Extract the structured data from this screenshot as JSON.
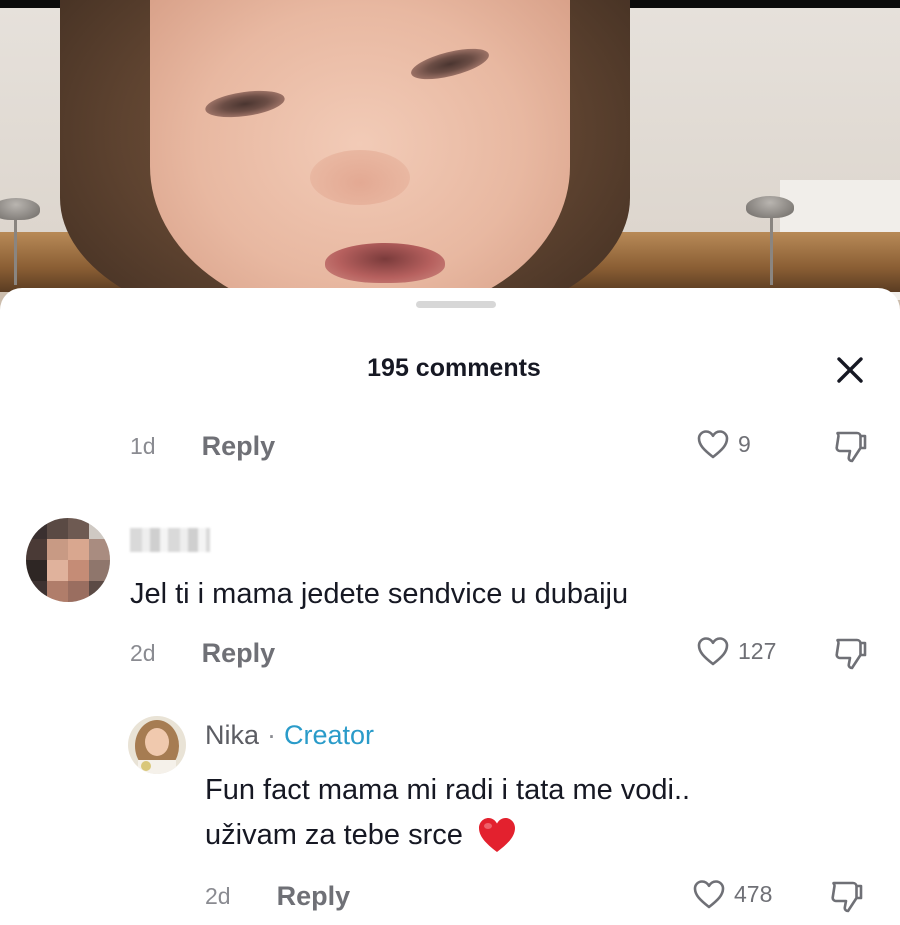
{
  "header": {
    "title": "195 comments"
  },
  "comments": [
    {
      "time": "1d",
      "reply_label": "Reply",
      "likes": "9"
    },
    {
      "text": "Jel ti i mama jedete sendvice u dubaiju",
      "time": "2d",
      "reply_label": "Reply",
      "likes": "127"
    },
    {
      "author": "Nika",
      "separator": "·",
      "badge": "Creator",
      "text_line1": "Fun fact mama mi radi i tata me vodi..",
      "text_line2": "uživam za tebe srce",
      "time": "2d",
      "reply_label": "Reply",
      "likes": "478"
    }
  ],
  "colors": {
    "creator_badge": "#2a9bc9",
    "text": "#161823",
    "muted": "#8a8b91",
    "emoji_heart": "#e3212e"
  },
  "icons": [
    "close-icon",
    "heart-outline-icon",
    "dislike-icon",
    "red-heart-emoji"
  ]
}
